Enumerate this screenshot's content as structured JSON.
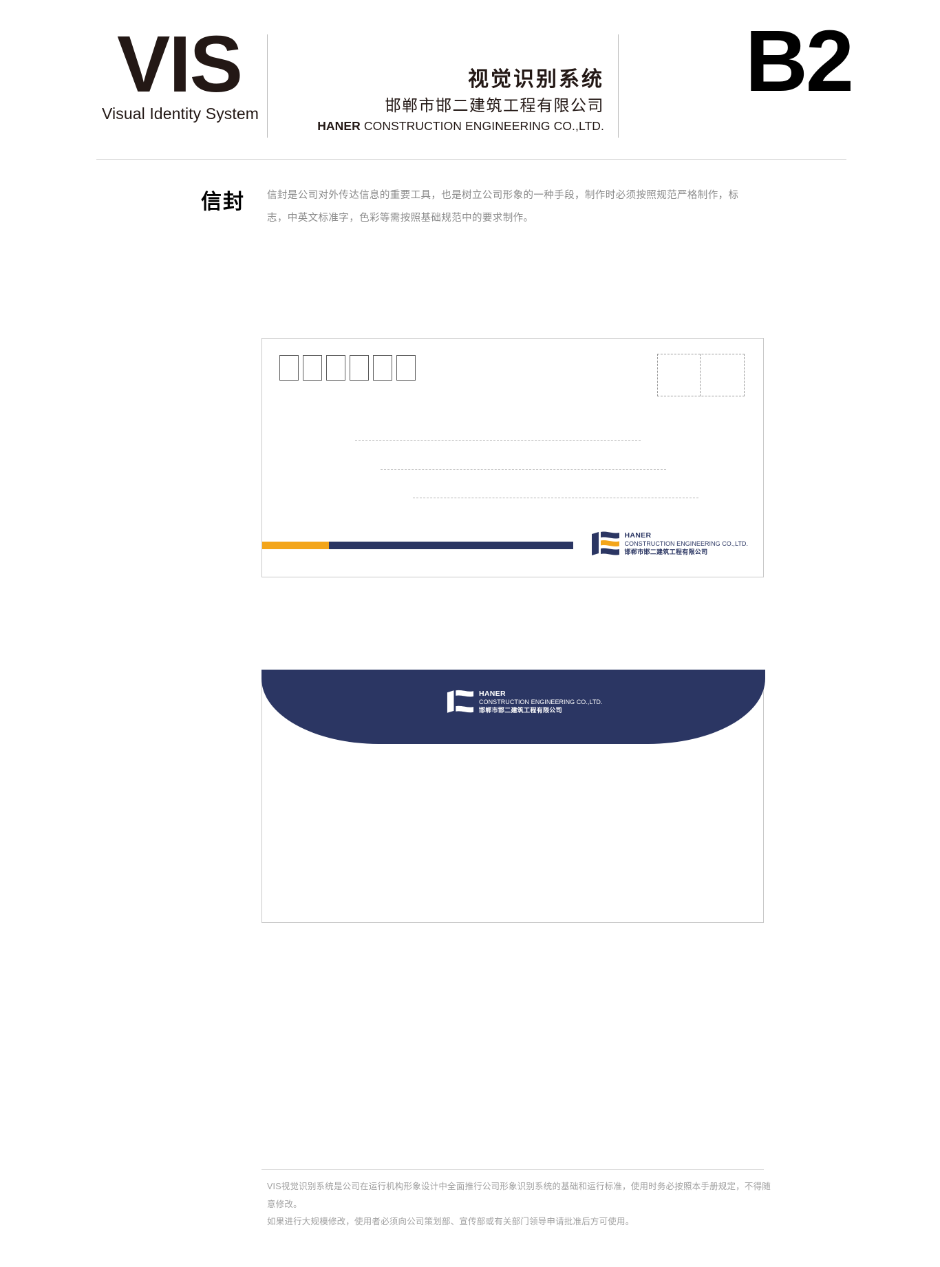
{
  "header": {
    "vis_acronym": "VIS",
    "vis_subtitle": "Visual Identity System",
    "title_cn": "视觉识别系统",
    "company_cn": "邯郸市邯二建筑工程有限公司",
    "company_en_bold": "HANER",
    "company_en_rest": " CONSTRUCTION ENGINEERING CO.,LTD.",
    "page_code": "B2"
  },
  "section": {
    "title": "信封",
    "description_line_1": "信封是公司对外传达信息的重要工具，也是树立公司形象的一种手段，制作时必须按照规范严格制作，标",
    "description_line_2": "志，中英文标准字，色彩等需按照基础规范中的要求制作。"
  },
  "logo": {
    "name_en": "HANER",
    "tagline_en": "CONSTRUCTION ENGINEERING CO.,LTD.",
    "name_cn": "邯郸市邯二建筑工程有限公司",
    "mark_icon": "haner-flag-e-icon"
  },
  "envelope_front": {
    "postcode_box_count": 6,
    "stamp_area_label": "stamp-placement-area",
    "address_line_count": 3,
    "bar_color_accent": "#f3a51a",
    "bar_color_primary": "#2b3663"
  },
  "envelope_back": {
    "flap_color": "#2b3663"
  },
  "colors": {
    "navy": "#2b3663",
    "orange": "#f3a51a",
    "ink": "#231815",
    "muted": "#8b8b8b"
  },
  "footer": {
    "line_1": "VIS视觉识别系统是公司在运行机构形象设计中全面推行公司形象识别系统的基础和运行标准，使用时务必按照本手册规定，不得随意修改。",
    "line_2": "如果进行大规模修改，使用者必须向公司策划部、宣传部或有关部门领导申请批准后方可使用。"
  }
}
